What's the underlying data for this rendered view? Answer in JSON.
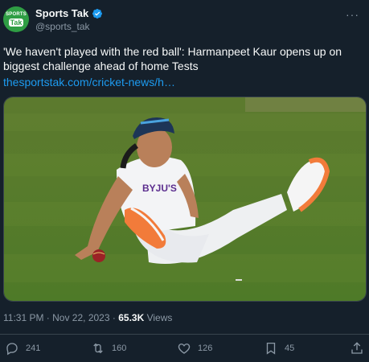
{
  "author": {
    "display_name": "Sports Tak",
    "handle": "@sports_tak",
    "avatar_text_top": "SPORTS",
    "avatar_text_bottom": "Tak",
    "verified": true
  },
  "tweet": {
    "text": "'We haven't played with the red ball': Harmanpeet Kaur opens up on biggest challenge ahead of home Tests",
    "link": "thesportstak.com/cricket-news/h…",
    "image": {
      "jersey_text": "BYJU'S",
      "description_icon": "cricket-photo"
    },
    "timestamp": "11:31 PM · Nov 22, 2023",
    "views_count": "65.3K",
    "views_label": "Views"
  },
  "actions": {
    "replies": "241",
    "retweets": "160",
    "likes": "126",
    "bookmarks": "45"
  },
  "colors": {
    "background": "#15202b",
    "accent": "#1d9bf0",
    "secondary_text": "#8b98a5"
  }
}
